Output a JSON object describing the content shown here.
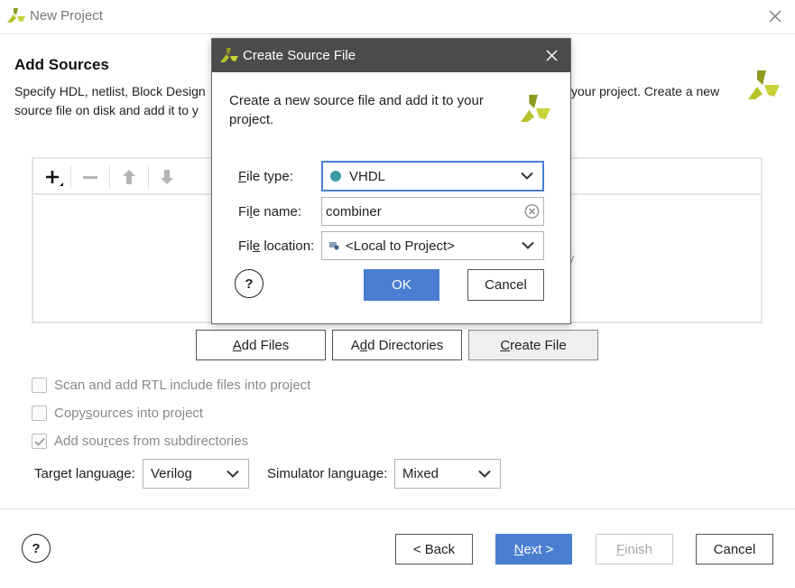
{
  "window": {
    "title": "New Project"
  },
  "page": {
    "heading": "Add Sources",
    "description_line1_left": "Specify HDL, netlist, Block Design",
    "description_line1_right": "your project. Create a new",
    "description_line2_left": "source file on disk and add it to y",
    "partial_right_y": "y"
  },
  "list_buttons": {
    "add_files_pre": "",
    "add_files_u": "A",
    "add_files_post": "dd Files",
    "add_dirs_pre": "A",
    "add_dirs_u": "d",
    "add_dirs_post": "d Directories",
    "create_file_pre": "",
    "create_file_u": "C",
    "create_file_post": "reate File"
  },
  "options": {
    "scan_rtl": "Scan and add RTL include files into project",
    "copy_pre": "Copy ",
    "copy_u": "s",
    "copy_post": "ources into project",
    "subdirs_pre": "Add sou",
    "subdirs_u": "r",
    "subdirs_post": "ces from subdirectories",
    "copy_checked": false,
    "subdirs_checked": true,
    "scan_checked": false
  },
  "languages": {
    "target_label": "Target language:",
    "target_value": "Verilog",
    "simulator_label": "Simulator language:",
    "simulator_value": "Mixed"
  },
  "footer": {
    "help": "?",
    "back": "< Back",
    "next_u": "N",
    "next_post": "ext >",
    "finish_u": "F",
    "finish_post": "inish",
    "cancel": "Cancel"
  },
  "dialog": {
    "title": "Create Source File",
    "description": "Create a new source file and add it to your project.",
    "file_type_label_u": "F",
    "file_type_label_post": "ile type:",
    "file_type_value": "VHDL",
    "file_name_label_pre": "Fi",
    "file_name_label_u": "l",
    "file_name_label_post": "e name:",
    "file_name_value": "combiner",
    "file_location_label_pre": "Fil",
    "file_location_label_u": "e",
    "file_location_label_post": " location:",
    "file_location_value": "<Local to Project>",
    "ok": "OK",
    "cancel": "Cancel",
    "help": "?"
  },
  "colors": {
    "accent": "#4a7ed1",
    "dialog_titlebar": "#4b4b4b",
    "vhdl_dot": "#3c9aa6",
    "logo": "#b7c22c"
  },
  "icons": [
    "app-logo-icon",
    "close-icon",
    "plus-icon",
    "minus-icon",
    "arrow-up-icon",
    "arrow-down-icon",
    "chevron-down-icon",
    "clear-icon",
    "folder-icon",
    "check-icon"
  ]
}
